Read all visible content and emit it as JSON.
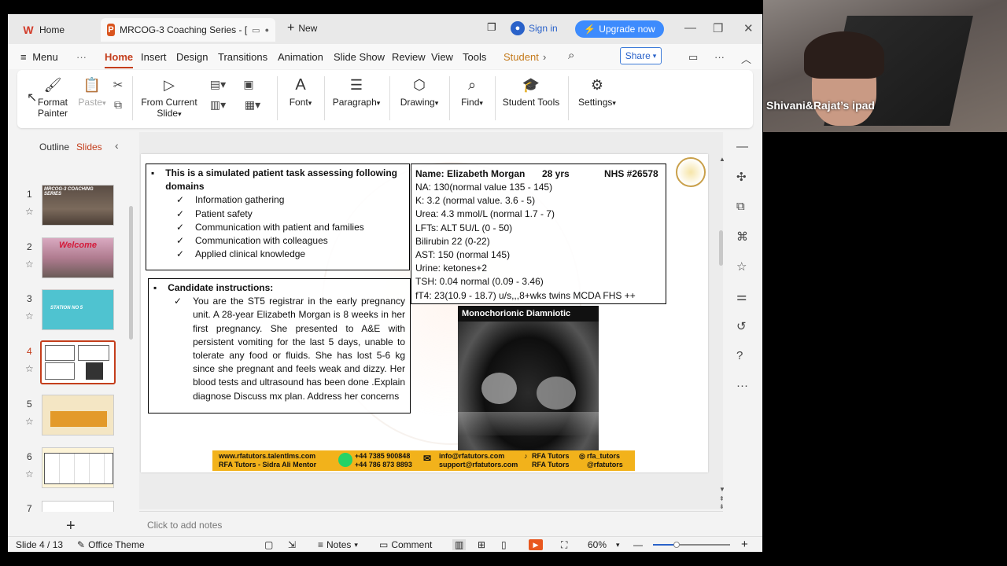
{
  "tabs": {
    "home_label": "Home",
    "doc_label": "MRCOG-3 Coaching Series - [",
    "new_label": "New"
  },
  "account": {
    "sign_in": "Sign in",
    "upgrade": "Upgrade now"
  },
  "menu": {
    "menu_label": "Menu",
    "items": [
      "Home",
      "Insert",
      "Design",
      "Transitions",
      "Animation",
      "Slide Show",
      "Review",
      "View",
      "Tools",
      "Student"
    ],
    "share": "Share"
  },
  "ribbon": {
    "format_painter": "Format Painter",
    "paste": "Paste",
    "from_current": "From Current",
    "slide": "Slide",
    "font": "Font",
    "paragraph": "Paragraph",
    "drawing": "Drawing",
    "find": "Find",
    "student_tools": "Student Tools",
    "settings": "Settings"
  },
  "panel": {
    "outline": "Outline",
    "slides": "Slides",
    "slide_numbers": [
      "1",
      "2",
      "3",
      "4",
      "5",
      "6",
      "7"
    ]
  },
  "thumb_text": {
    "t1": "MRCOG-3 COACHING SERIES",
    "t2": "Welcome",
    "t3": "STATION NO 5"
  },
  "slide": {
    "box1_title": "This is a simulated patient task assessing following domains",
    "domains": [
      "Information gathering",
      "Patient safety",
      "Communication with patient and families",
      "Communication with colleagues",
      "Applied clinical knowledge"
    ],
    "box2_title": "Candidate instructions:",
    "instructions": "You are the ST5 registrar in the early pregnancy unit. A 28-year Elizabeth Morgan is 8 weeks in her first pregnancy. She presented to A&E with persistent vomiting for the last 5 days, unable to tolerate any food or fluids. She has lost 5-6 kg since she pregnant and feels weak and dizzy. Her blood tests and ultrasound has been done .Explain diagnose Discuss mx plan. Address her concerns",
    "patient_name": "Name: Elizabeth Morgan",
    "patient_age": "28 yrs",
    "patient_nhs": "NHS #26578",
    "labs": [
      "NA: 130(normal value 135 - 145)",
      "K: 3.2 (normal value. 3.6 - 5)",
      "Urea: 4.3 mmol/L (normal 1.7 - 7)",
      "LFTs: ALT 5U/L (0 - 50)",
      "Bilirubin 22 (0-22)",
      "AST: 150  (normal 145)",
      "Urine: ketones+2",
      "TSH: 0.04 normal (0.09 - 3.46)",
      "fT4: 23(10.9 - 18.7)  u/s,,,8+wks twins MCDA FHS ++"
    ],
    "us_title": "Monochorionic Diamniotic",
    "footer_web": "www.rfatutors.talentlms.com",
    "footer_mentor": "RFA Tutors - Sidra Ali Mentor",
    "footer_phone1": "+44 7385 900848",
    "footer_phone2": "+44 786 873 8893",
    "footer_email1": "info@rfatutors.com",
    "footer_email2": "support@rfatutors.com",
    "footer_tiktok1": "RFA Tutors",
    "footer_tiktok2": "RFA Tutors",
    "footer_insta1": "rfa_tutors",
    "footer_insta2": "@rfatutors"
  },
  "notes_placeholder": "Click to add notes",
  "status": {
    "slide_count": "Slide 4 / 13",
    "theme": "Office Theme",
    "notes": "Notes",
    "comment": "Comment",
    "zoom": "60%"
  },
  "video": {
    "participant": "Shivani&Rajat’s ipad"
  },
  "colors": {
    "accent": "#c43e1c",
    "upgrade": "#3d8bfd",
    "footer_bar": "#f2b21b"
  }
}
